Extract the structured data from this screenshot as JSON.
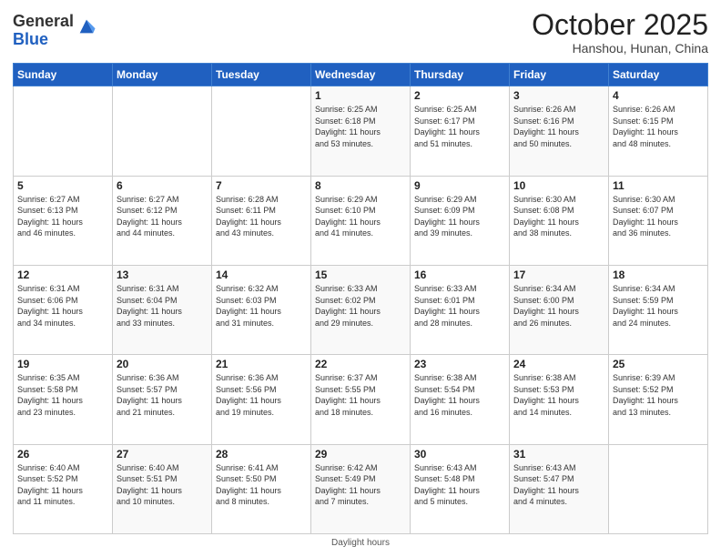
{
  "header": {
    "logo_line1": "General",
    "logo_line2": "Blue",
    "month": "October 2025",
    "location": "Hanshou, Hunan, China"
  },
  "weekdays": [
    "Sunday",
    "Monday",
    "Tuesday",
    "Wednesday",
    "Thursday",
    "Friday",
    "Saturday"
  ],
  "weeks": [
    [
      {
        "day": "",
        "info": ""
      },
      {
        "day": "",
        "info": ""
      },
      {
        "day": "",
        "info": ""
      },
      {
        "day": "1",
        "info": "Sunrise: 6:25 AM\nSunset: 6:18 PM\nDaylight: 11 hours\nand 53 minutes."
      },
      {
        "day": "2",
        "info": "Sunrise: 6:25 AM\nSunset: 6:17 PM\nDaylight: 11 hours\nand 51 minutes."
      },
      {
        "day": "3",
        "info": "Sunrise: 6:26 AM\nSunset: 6:16 PM\nDaylight: 11 hours\nand 50 minutes."
      },
      {
        "day": "4",
        "info": "Sunrise: 6:26 AM\nSunset: 6:15 PM\nDaylight: 11 hours\nand 48 minutes."
      }
    ],
    [
      {
        "day": "5",
        "info": "Sunrise: 6:27 AM\nSunset: 6:13 PM\nDaylight: 11 hours\nand 46 minutes."
      },
      {
        "day": "6",
        "info": "Sunrise: 6:27 AM\nSunset: 6:12 PM\nDaylight: 11 hours\nand 44 minutes."
      },
      {
        "day": "7",
        "info": "Sunrise: 6:28 AM\nSunset: 6:11 PM\nDaylight: 11 hours\nand 43 minutes."
      },
      {
        "day": "8",
        "info": "Sunrise: 6:29 AM\nSunset: 6:10 PM\nDaylight: 11 hours\nand 41 minutes."
      },
      {
        "day": "9",
        "info": "Sunrise: 6:29 AM\nSunset: 6:09 PM\nDaylight: 11 hours\nand 39 minutes."
      },
      {
        "day": "10",
        "info": "Sunrise: 6:30 AM\nSunset: 6:08 PM\nDaylight: 11 hours\nand 38 minutes."
      },
      {
        "day": "11",
        "info": "Sunrise: 6:30 AM\nSunset: 6:07 PM\nDaylight: 11 hours\nand 36 minutes."
      }
    ],
    [
      {
        "day": "12",
        "info": "Sunrise: 6:31 AM\nSunset: 6:06 PM\nDaylight: 11 hours\nand 34 minutes."
      },
      {
        "day": "13",
        "info": "Sunrise: 6:31 AM\nSunset: 6:04 PM\nDaylight: 11 hours\nand 33 minutes."
      },
      {
        "day": "14",
        "info": "Sunrise: 6:32 AM\nSunset: 6:03 PM\nDaylight: 11 hours\nand 31 minutes."
      },
      {
        "day": "15",
        "info": "Sunrise: 6:33 AM\nSunset: 6:02 PM\nDaylight: 11 hours\nand 29 minutes."
      },
      {
        "day": "16",
        "info": "Sunrise: 6:33 AM\nSunset: 6:01 PM\nDaylight: 11 hours\nand 28 minutes."
      },
      {
        "day": "17",
        "info": "Sunrise: 6:34 AM\nSunset: 6:00 PM\nDaylight: 11 hours\nand 26 minutes."
      },
      {
        "day": "18",
        "info": "Sunrise: 6:34 AM\nSunset: 5:59 PM\nDaylight: 11 hours\nand 24 minutes."
      }
    ],
    [
      {
        "day": "19",
        "info": "Sunrise: 6:35 AM\nSunset: 5:58 PM\nDaylight: 11 hours\nand 23 minutes."
      },
      {
        "day": "20",
        "info": "Sunrise: 6:36 AM\nSunset: 5:57 PM\nDaylight: 11 hours\nand 21 minutes."
      },
      {
        "day": "21",
        "info": "Sunrise: 6:36 AM\nSunset: 5:56 PM\nDaylight: 11 hours\nand 19 minutes."
      },
      {
        "day": "22",
        "info": "Sunrise: 6:37 AM\nSunset: 5:55 PM\nDaylight: 11 hours\nand 18 minutes."
      },
      {
        "day": "23",
        "info": "Sunrise: 6:38 AM\nSunset: 5:54 PM\nDaylight: 11 hours\nand 16 minutes."
      },
      {
        "day": "24",
        "info": "Sunrise: 6:38 AM\nSunset: 5:53 PM\nDaylight: 11 hours\nand 14 minutes."
      },
      {
        "day": "25",
        "info": "Sunrise: 6:39 AM\nSunset: 5:52 PM\nDaylight: 11 hours\nand 13 minutes."
      }
    ],
    [
      {
        "day": "26",
        "info": "Sunrise: 6:40 AM\nSunset: 5:52 PM\nDaylight: 11 hours\nand 11 minutes."
      },
      {
        "day": "27",
        "info": "Sunrise: 6:40 AM\nSunset: 5:51 PM\nDaylight: 11 hours\nand 10 minutes."
      },
      {
        "day": "28",
        "info": "Sunrise: 6:41 AM\nSunset: 5:50 PM\nDaylight: 11 hours\nand 8 minutes."
      },
      {
        "day": "29",
        "info": "Sunrise: 6:42 AM\nSunset: 5:49 PM\nDaylight: 11 hours\nand 7 minutes."
      },
      {
        "day": "30",
        "info": "Sunrise: 6:43 AM\nSunset: 5:48 PM\nDaylight: 11 hours\nand 5 minutes."
      },
      {
        "day": "31",
        "info": "Sunrise: 6:43 AM\nSunset: 5:47 PM\nDaylight: 11 hours\nand 4 minutes."
      },
      {
        "day": "",
        "info": ""
      }
    ]
  ],
  "footer": "Daylight hours"
}
